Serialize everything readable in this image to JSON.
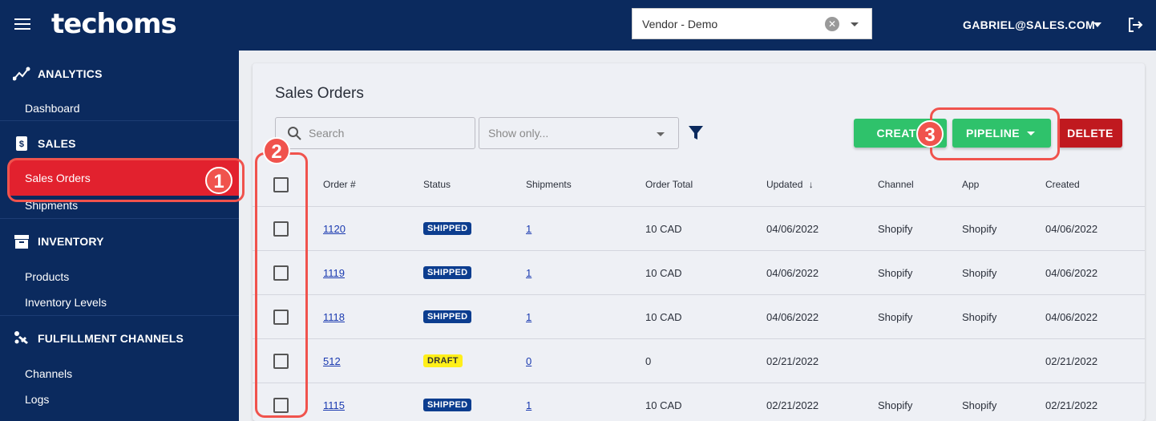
{
  "app": {
    "logo": "techoms",
    "vendor": "Vendor - Demo",
    "user": "GABRIEL@SALES.COM"
  },
  "sidebar": {
    "sections": [
      {
        "label": "ANALYTICS",
        "icon": "analytics-icon",
        "items": [
          "Dashboard"
        ]
      },
      {
        "label": "SALES",
        "icon": "dollar-doc-icon",
        "items": [
          "Sales Orders",
          "Shipments"
        ]
      },
      {
        "label": "INVENTORY",
        "icon": "archive-box-icon",
        "items": [
          "Products",
          "Inventory Levels"
        ]
      },
      {
        "label": "FULFILLMENT CHANNELS",
        "icon": "channels-icon",
        "items": [
          "Channels",
          "Logs"
        ]
      }
    ],
    "active": "Sales Orders"
  },
  "main": {
    "title": "Sales Orders",
    "search_placeholder": "Search",
    "showonly_placeholder": "Show only...",
    "buttons": {
      "create": "CREATE",
      "pipeline": "PIPELINE",
      "delete": "DELETE"
    },
    "columns": [
      "Order #",
      "Status",
      "Shipments",
      "Order Total",
      "Updated",
      "Channel",
      "App",
      "Created"
    ],
    "sort_indicator": "↓",
    "rows": [
      {
        "order": "1120",
        "status": "SHIPPED",
        "shipments": "1",
        "total": "10 CAD",
        "updated": "04/06/2022",
        "channel": "Shopify",
        "app": "Shopify",
        "created": "04/06/2022"
      },
      {
        "order": "1119",
        "status": "SHIPPED",
        "shipments": "1",
        "total": "10 CAD",
        "updated": "04/06/2022",
        "channel": "Shopify",
        "app": "Shopify",
        "created": "04/06/2022"
      },
      {
        "order": "1118",
        "status": "SHIPPED",
        "shipments": "1",
        "total": "10 CAD",
        "updated": "04/06/2022",
        "channel": "Shopify",
        "app": "Shopify",
        "created": "04/06/2022"
      },
      {
        "order": "512",
        "status": "DRAFT",
        "shipments": "0",
        "total": "0",
        "updated": "02/21/2022",
        "channel": "",
        "app": "",
        "created": "02/21/2022"
      },
      {
        "order": "1115",
        "status": "SHIPPED",
        "shipments": "1",
        "total": "10 CAD",
        "updated": "02/21/2022",
        "channel": "Shopify",
        "app": "Shopify",
        "created": "02/21/2022"
      }
    ]
  },
  "annotations": [
    "1",
    "2",
    "3"
  ],
  "colors": {
    "nav": "#0b2a5e",
    "active": "#e2212e",
    "green": "#2fc26b",
    "red": "#c0191f",
    "annotation": "#f0534d"
  }
}
